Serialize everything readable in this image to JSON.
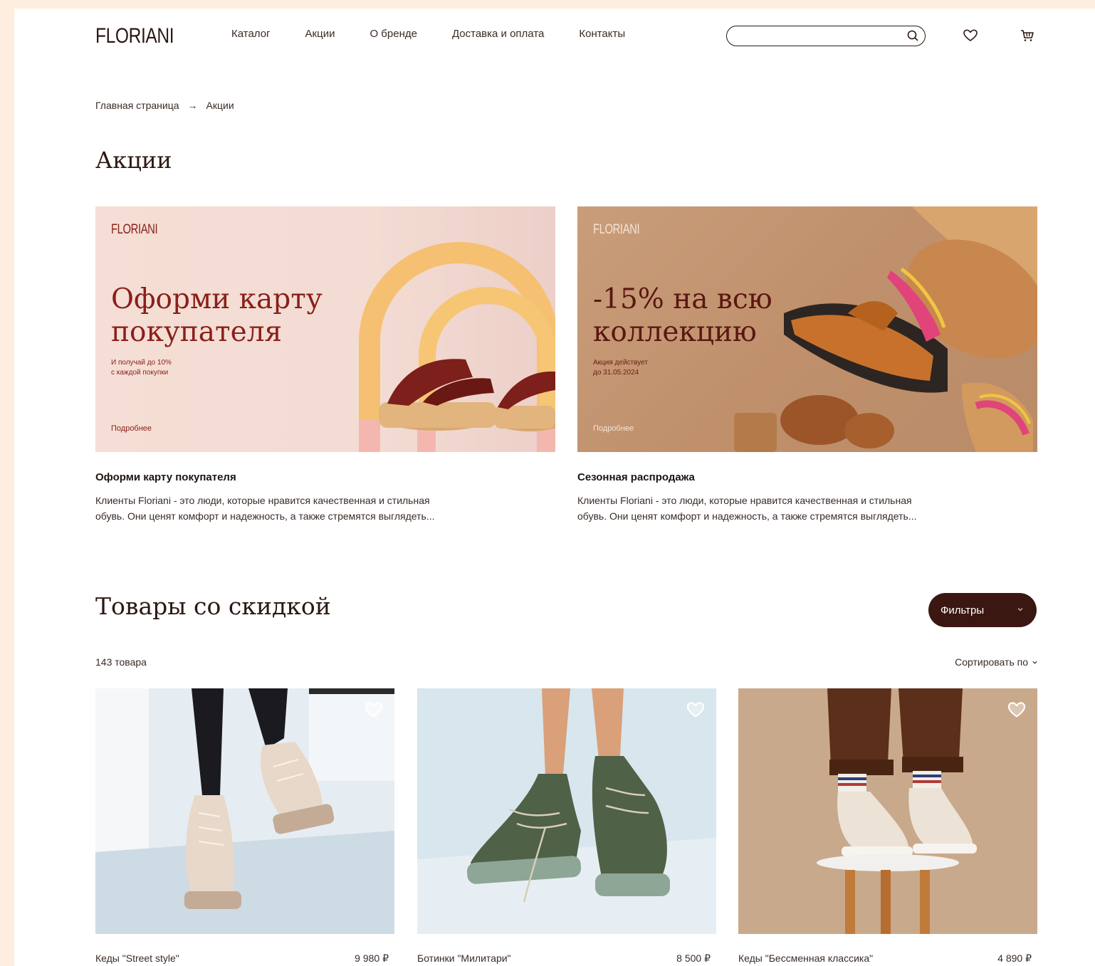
{
  "header": {
    "logo": "FLORIANI",
    "nav": [
      "Каталог",
      "Акции",
      "О бренде",
      "Доставка и оплата",
      "Контакты"
    ],
    "search_placeholder": ""
  },
  "breadcrumb": {
    "home": "Главная страница",
    "arrow": "→",
    "current": "Акции"
  },
  "page_title": "Акции",
  "promos": [
    {
      "banner_logo": "FLORIANI",
      "banner_heading_1": "Оформи карту",
      "banner_heading_2": "покупателя",
      "banner_sub_1": "И получай до 10%",
      "banner_sub_2": "с каждой покупки",
      "banner_more": "Подробнее",
      "title": "Оформи карту покупателя",
      "text_1": "Клиенты Floriani - это люди, которые нравится качественная и стильная",
      "text_2": "обувь. Они ценят комфорт и надежность, а также стремятся выглядеть..."
    },
    {
      "banner_logo": "FLORIANI",
      "banner_heading_1": "-15% на всю",
      "banner_heading_2": "коллекцию",
      "banner_sub_1": "Акция действует",
      "banner_sub_2": "до 31.05.2024",
      "banner_more": "Подробнее",
      "title": "Сезонная распродажа",
      "text_1": "Клиенты Floriani - это люди, которые нравится качественная и стильная",
      "text_2": "обувь. Они ценят комфорт и надежность, а также стремятся выглядеть..."
    }
  ],
  "discount_section": {
    "title": "Товары со скидкой",
    "filters_label": "Фильтры",
    "count": "143 товара",
    "sort_label": "Сортировать по"
  },
  "products": [
    {
      "name": "Кеды \"Street style\"",
      "price": "9 980 ₽"
    },
    {
      "name": "Ботинки \"Милитари\"",
      "price": "8 500 ₽"
    },
    {
      "name": "Кеды \"Бессменная классика\"",
      "price": "4 890 ₽"
    }
  ],
  "colors": {
    "brand_dark": "#3b1712",
    "banner_red": "#8a1f1a",
    "page_bg": "#fdeee0"
  }
}
